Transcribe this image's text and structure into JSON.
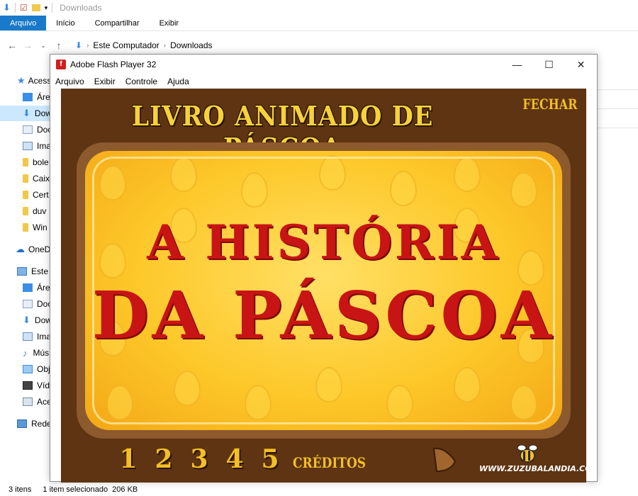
{
  "explorer": {
    "window_title": "Downloads",
    "ribbon_tabs": [
      "Arquivo",
      "Início",
      "Compartilhar",
      "Exibir"
    ],
    "breadcrumb": [
      "Este Computador",
      "Downloads"
    ],
    "sidebar": [
      {
        "label": "Acess",
        "icon": "pin-icon"
      },
      {
        "label": "Área",
        "icon": "desktop-icon"
      },
      {
        "label": "Dow",
        "icon": "download-icon"
      },
      {
        "label": "Doc",
        "icon": "document-icon"
      },
      {
        "label": "Ima",
        "icon": "image-icon"
      },
      {
        "label": "bole",
        "icon": "folder-icon"
      },
      {
        "label": "Caix",
        "icon": "folder-icon"
      },
      {
        "label": "Cert",
        "icon": "folder-icon"
      },
      {
        "label": "duv",
        "icon": "folder-icon"
      },
      {
        "label": "Win",
        "icon": "folder-icon"
      },
      {
        "label": "OneD",
        "icon": "cloud-icon"
      },
      {
        "label": "Este C",
        "icon": "computer-icon"
      },
      {
        "label": "Área",
        "icon": "desktop-icon"
      },
      {
        "label": "Doc",
        "icon": "document-icon"
      },
      {
        "label": "Dow",
        "icon": "download-icon"
      },
      {
        "label": "Ima",
        "icon": "image-icon"
      },
      {
        "label": "Mús",
        "icon": "music-icon"
      },
      {
        "label": "Obj",
        "icon": "cube-icon"
      },
      {
        "label": "Víde",
        "icon": "video-icon"
      },
      {
        "label": "Ace",
        "icon": "drive-icon"
      },
      {
        "label": "Rede",
        "icon": "network-icon"
      }
    ],
    "status": {
      "count": "3 itens",
      "selection": "1 item selecionado",
      "size": "206 KB"
    }
  },
  "flash": {
    "title": "Adobe Flash Player 32",
    "menu": [
      "Arquivo",
      "Exibir",
      "Controle",
      "Ajuda"
    ],
    "controls": {
      "minimize": "—",
      "maximize": "☐",
      "close": "✕"
    },
    "stage": {
      "title": "LIVRO ANIMADO DE PÁSCOA",
      "close_label": "FECHAR",
      "line1": "A HISTÓRIA",
      "line2": "DA PÁSCOA",
      "pages": [
        "1",
        "2",
        "3",
        "4",
        "5"
      ],
      "credits": "CRÉDITOS",
      "site": "WWW.ZUZUBALANDIA.COM.BR"
    }
  }
}
